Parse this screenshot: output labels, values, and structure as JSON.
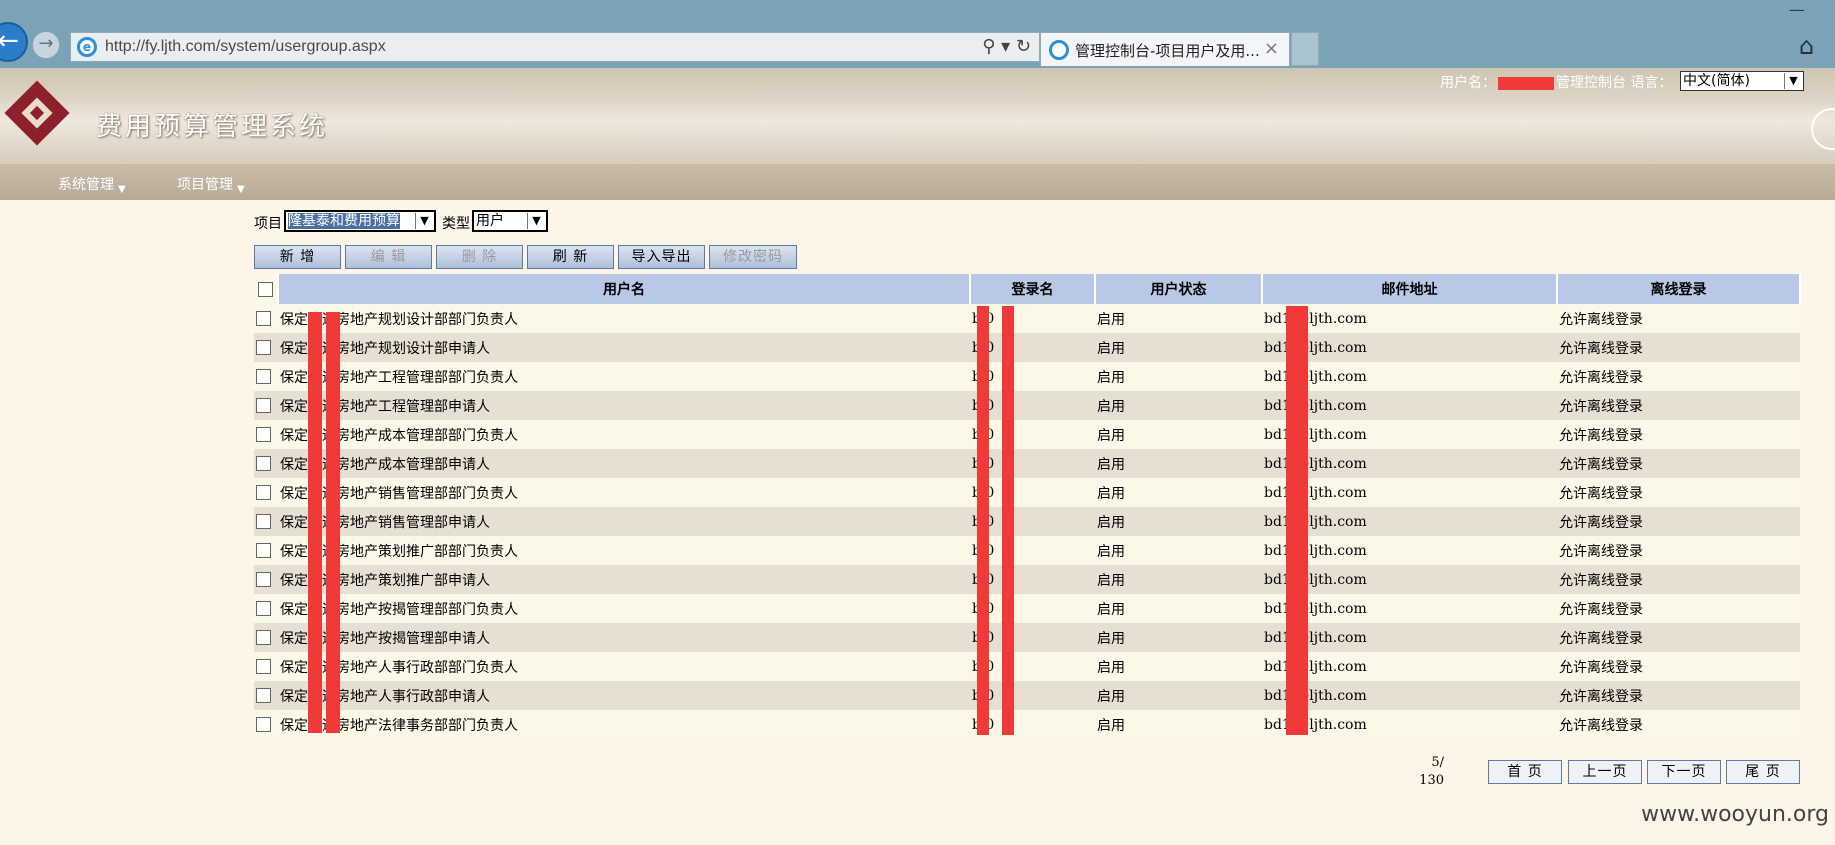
{
  "browser": {
    "url": "http://fy.ljth.com/system/usergroup.aspx",
    "tab_title": "管理控制台-项目用户及用...",
    "tab_close": "×",
    "back_glyph": "←",
    "forward_glyph": "→",
    "tools_glyph": "⚲ ▾ ↻",
    "minimize_glyph": "—",
    "home_glyph": "⌂"
  },
  "header": {
    "app_title": "费用预算管理系统",
    "user_label": "用户名：",
    "console_link": "管理控制台",
    "language_label": "语言：",
    "language_value": "中文(简体)"
  },
  "menu": [
    {
      "label": "系统管理",
      "caret": "▼"
    },
    {
      "label": "项目管理",
      "caret": "▼"
    }
  ],
  "filters": {
    "project_label": "项目",
    "project_value": "隆基泰和费用预算",
    "type_label": "类型",
    "type_value": "用户",
    "arrow": "▼"
  },
  "toolbar": {
    "add": "新 增",
    "edit": "编 辑",
    "delete": "删 除",
    "refresh": "刷 新",
    "import_export": "导入导出",
    "change_password": "修改密码"
  },
  "table": {
    "headers": [
      "用户名",
      "登录名",
      "用户状态",
      "邮件地址",
      "离线登录"
    ],
    "rows": [
      {
        "name": "保定隆远房地产规划设计部部门负责人",
        "login": "b     0",
        "status": "启用",
        "email": "bd1    @ljth.com",
        "offline": "允许离线登录"
      },
      {
        "name": "保定隆远房地产规划设计部申请人",
        "login": "b     0",
        "status": "启用",
        "email": "bd1    @ljth.com",
        "offline": "允许离线登录"
      },
      {
        "name": "保定隆远房地产工程管理部部门负责人",
        "login": "b     0",
        "status": "启用",
        "email": "bd1    @ljth.com",
        "offline": "允许离线登录"
      },
      {
        "name": "保定隆远房地产工程管理部申请人",
        "login": "b     0",
        "status": "启用",
        "email": "bd1    @ljth.com",
        "offline": "允许离线登录"
      },
      {
        "name": "保定隆远房地产成本管理部部门负责人",
        "login": "b     0",
        "status": "启用",
        "email": "bd1    @ljth.com",
        "offline": "允许离线登录"
      },
      {
        "name": "保定隆远房地产成本管理部申请人",
        "login": "b     0",
        "status": "启用",
        "email": "bd1    @ljth.com",
        "offline": "允许离线登录"
      },
      {
        "name": "保定隆远房地产销售管理部部门负责人",
        "login": "b     0",
        "status": "启用",
        "email": "bd1    @ljth.com",
        "offline": "允许离线登录"
      },
      {
        "name": "保定隆远房地产销售管理部申请人",
        "login": "b     0",
        "status": "启用",
        "email": "bd1    @ljth.com",
        "offline": "允许离线登录"
      },
      {
        "name": "保定隆远房地产策划推广部部门负责人",
        "login": "b     0",
        "status": "启用",
        "email": "bd1    @ljth.com",
        "offline": "允许离线登录"
      },
      {
        "name": "保定隆远房地产策划推广部申请人",
        "login": "b     0",
        "status": "启用",
        "email": "bd1    @ljth.com",
        "offline": "允许离线登录"
      },
      {
        "name": "保定隆远房地产按揭管理部部门负责人",
        "login": "b     0",
        "status": "启用",
        "email": "bd1    @ljth.com",
        "offline": "允许离线登录"
      },
      {
        "name": "保定隆远房地产按揭管理部申请人",
        "login": "b     0",
        "status": "启用",
        "email": "bd1    @ljth.com",
        "offline": "允许离线登录"
      },
      {
        "name": "保定隆远房地产人事行政部部门负责人",
        "login": "b     0",
        "status": "启用",
        "email": "bd1    @ljth.com",
        "offline": "允许离线登录"
      },
      {
        "name": "保定隆远房地产人事行政部申请人",
        "login": "b     0",
        "status": "启用",
        "email": "bd1    @ljth.com",
        "offline": "允许离线登录"
      },
      {
        "name": "保定隆远房地产法律事务部部门负责人",
        "login": "b     0",
        "status": "启用",
        "email": "bd1    @ljth.com",
        "offline": "允许离线登录"
      }
    ]
  },
  "pager": {
    "current": "5/",
    "total": "130",
    "first": "首 页",
    "prev": "上一页",
    "next": "下一页",
    "last": "尾 页"
  },
  "watermark": "www.wooyun.org",
  "colors": {
    "redaction": "#f03a3a",
    "header_row": "#b9c8e6",
    "row_odd": "#fbf8e8",
    "row_even": "#e7dfd1"
  }
}
